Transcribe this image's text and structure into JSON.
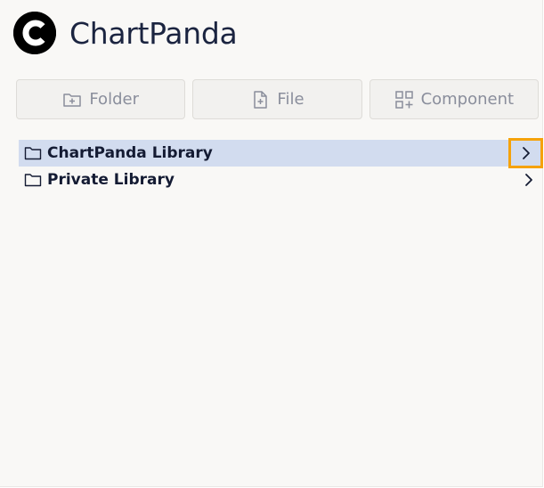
{
  "app": {
    "title": "ChartPanda",
    "logo_icon": "chartpanda-logo-icon"
  },
  "toolbar": {
    "buttons": [
      {
        "label": "Folder",
        "icon": "folder-plus-icon"
      },
      {
        "label": "File",
        "icon": "file-plus-icon"
      },
      {
        "label": "Component",
        "icon": "component-plus-icon"
      }
    ]
  },
  "tree": {
    "items": [
      {
        "label": "ChartPanda Library",
        "icon": "folder-icon",
        "selected": true,
        "expand_icon": "chevron-right-icon"
      },
      {
        "label": "Private Library",
        "icon": "folder-icon",
        "selected": false,
        "expand_icon": "chevron-right-icon"
      }
    ]
  },
  "colors": {
    "background": "#f9f8f6",
    "selected_row": "#d2dcef",
    "highlight": "#f5a20a",
    "text": "#1b2440",
    "muted_text": "#8a8e9c"
  }
}
